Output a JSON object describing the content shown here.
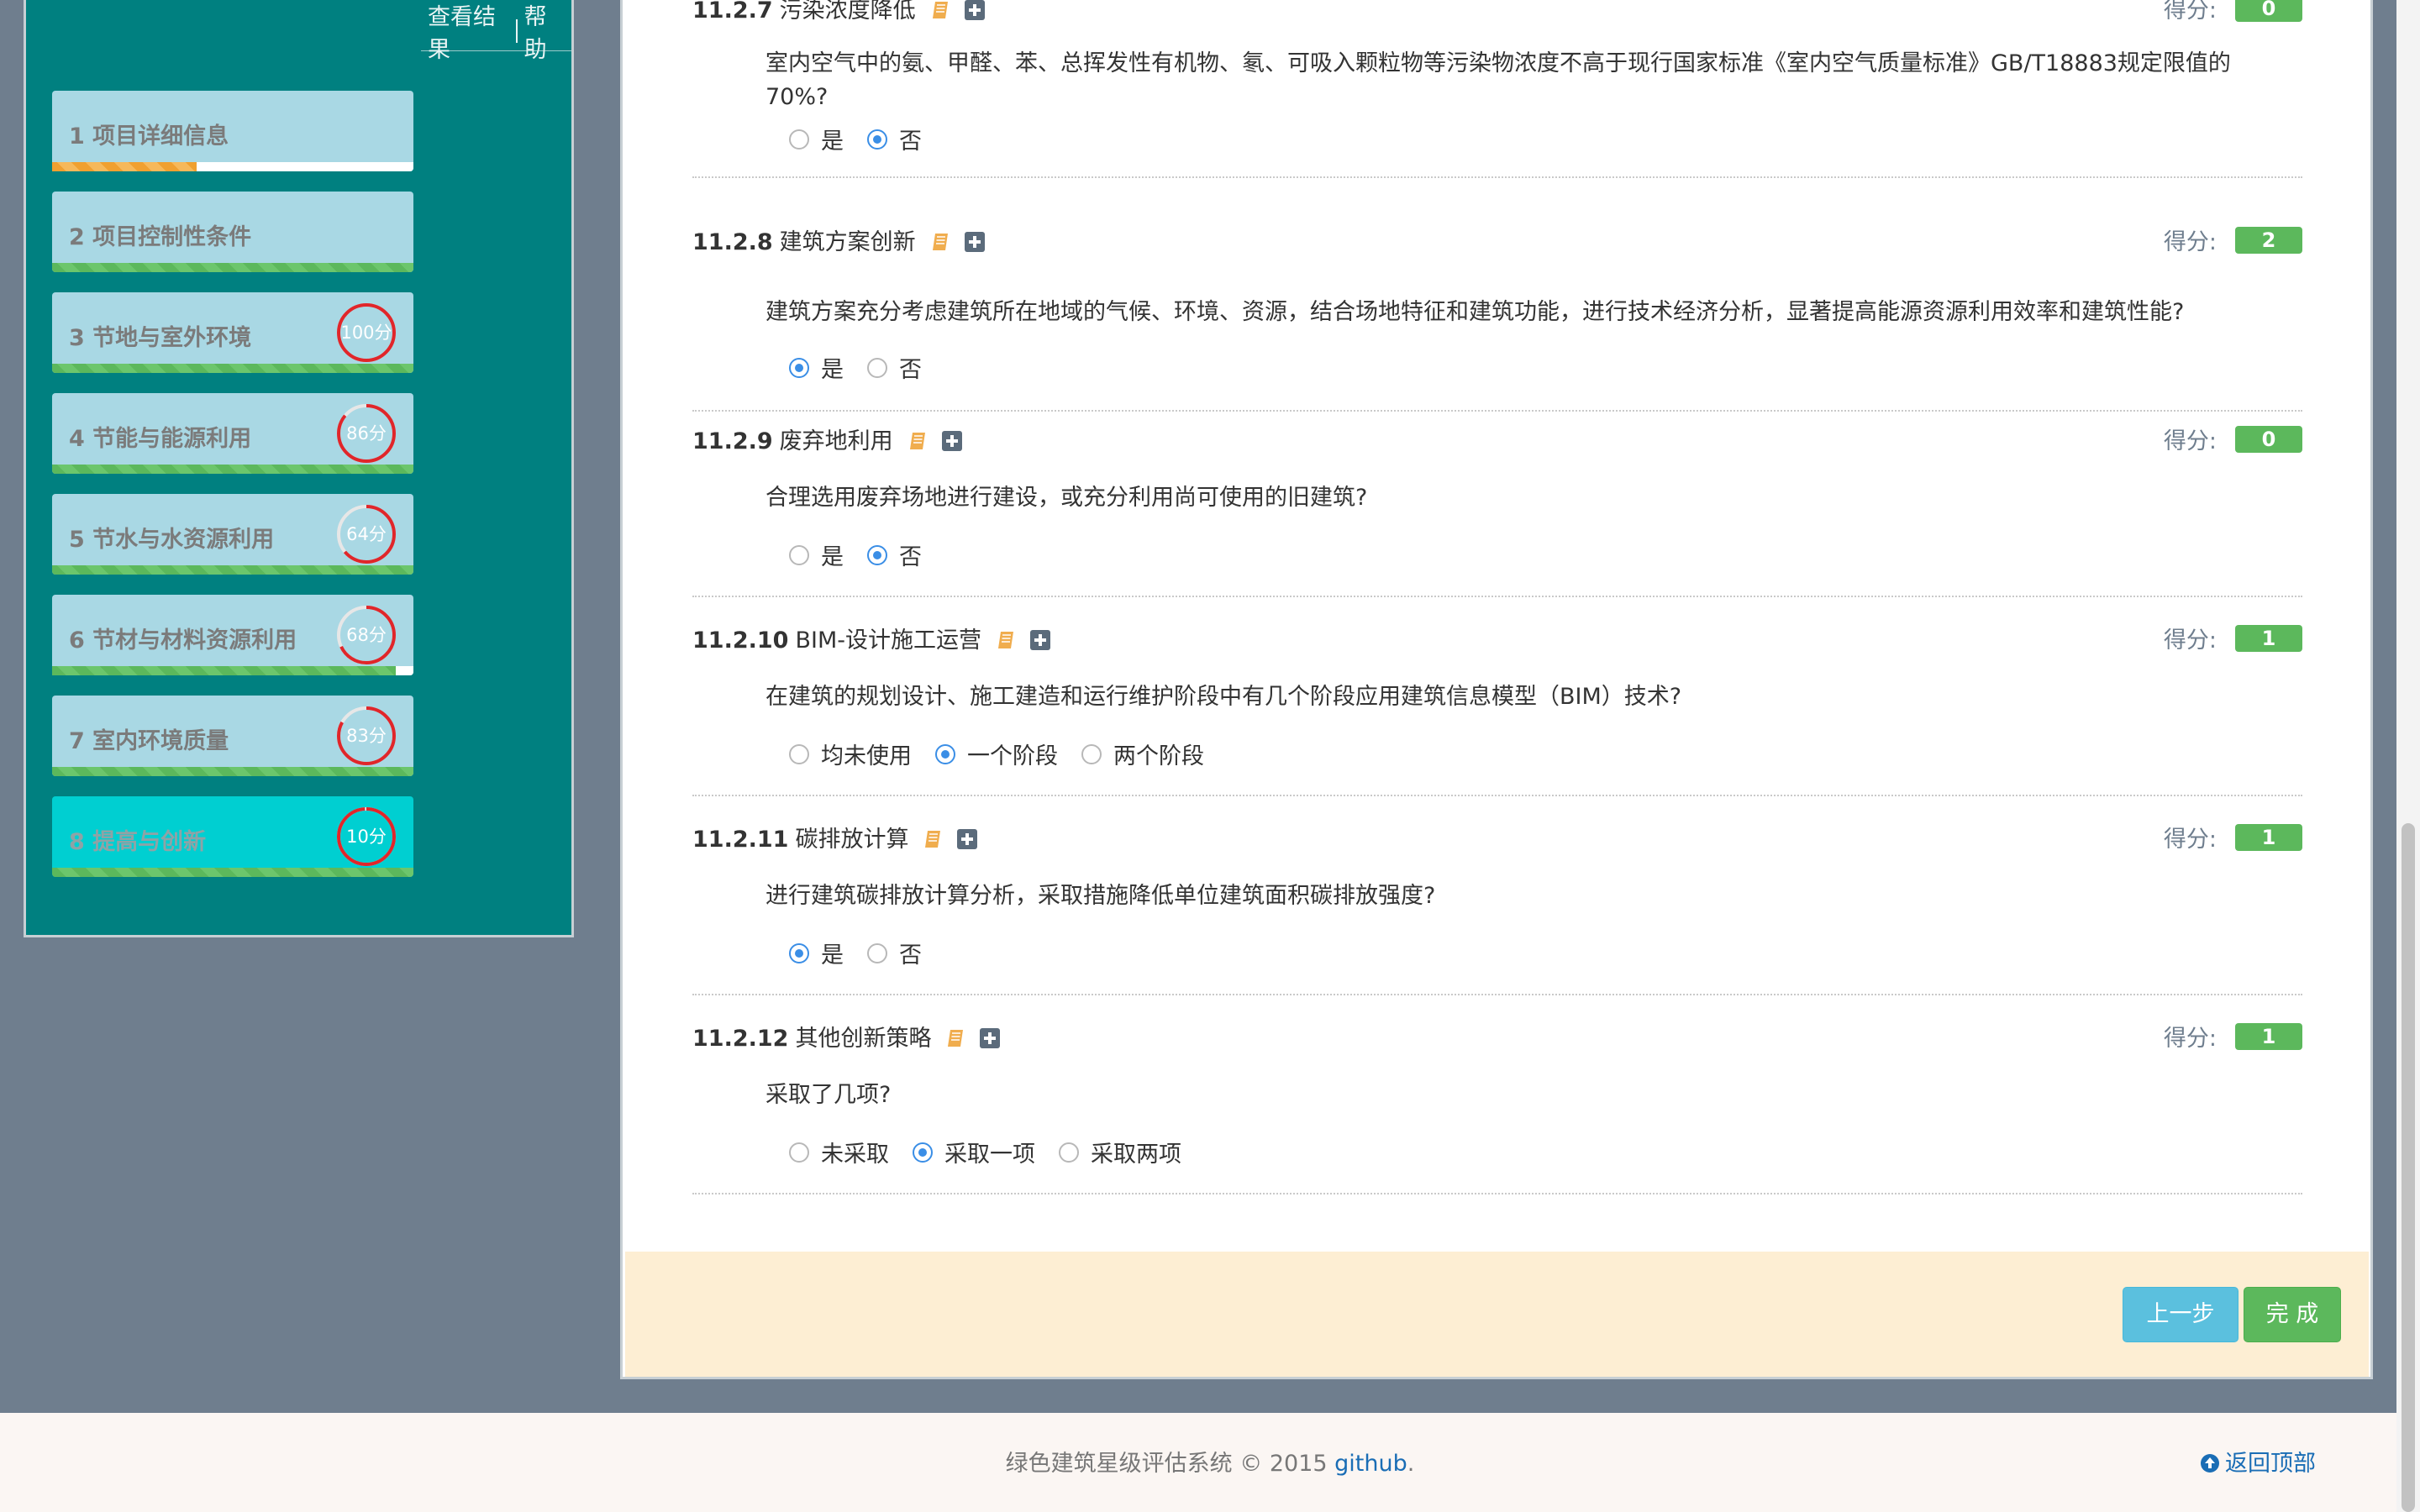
{
  "sidebar": {
    "links": {
      "results": "查看结果",
      "help": "帮助"
    },
    "steps": [
      {
        "label": "1 项目详细信息",
        "progress": 0.4,
        "progress_color": "orange"
      },
      {
        "label": "2 项目控制性条件",
        "progress": 1.0
      },
      {
        "label": "3 节地与室外环境",
        "score": "100分",
        "ring_fraction": 1.0
      },
      {
        "label": "4 节能与能源利用",
        "score": "86分",
        "ring_fraction": 0.86
      },
      {
        "label": "5 节水与水资源利用",
        "score": "64分",
        "ring_fraction": 0.64
      },
      {
        "label": "6 节材与材料资源利用",
        "score": "68分",
        "ring_fraction": 0.68,
        "progress": 0.95
      },
      {
        "label": "7 室内环境质量",
        "score": "83分",
        "ring_fraction": 0.83
      },
      {
        "label": "8 提高与创新",
        "score": "10分",
        "ring_fraction": 0.99,
        "active": true
      }
    ]
  },
  "score_label": "得分:",
  "items": [
    {
      "code": "11.2.7",
      "title": "污染浓度降低",
      "score": "0",
      "question": "室内空气中的氨、甲醛、苯、总挥发性有机物、氡、可吸入颗粒物等污染物浓度不高于现行国家标准《室内空气质量标准》GB/T18883规定限值的70%?",
      "options": [
        "是",
        "否"
      ],
      "selected": 1
    },
    {
      "code": "11.2.8",
      "title": "建筑方案创新",
      "score": "2",
      "question": "建筑方案充分考虑建筑所在地域的气候、环境、资源，结合场地特征和建筑功能，进行技术经济分析，显著提高能源资源利用效率和建筑性能?",
      "options": [
        "是",
        "否"
      ],
      "selected": 0
    },
    {
      "code": "11.2.9",
      "title": "废弃地利用",
      "score": "0",
      "question": "合理选用废弃场地进行建设，或充分利用尚可使用的旧建筑?",
      "options": [
        "是",
        "否"
      ],
      "selected": 1
    },
    {
      "code": "11.2.10",
      "title": "BIM-设计施工运营",
      "score": "1",
      "question": "在建筑的规划设计、施工建造和运行维护阶段中有几个阶段应用建筑信息模型（BIM）技术?",
      "options": [
        "均未使用",
        "一个阶段",
        "两个阶段"
      ],
      "selected": 1
    },
    {
      "code": "11.2.11",
      "title": "碳排放计算",
      "score": "1",
      "question": "进行建筑碳排放计算分析，采取措施降低单位建筑面积碳排放强度?",
      "options": [
        "是",
        "否"
      ],
      "selected": 0
    },
    {
      "code": "11.2.12",
      "title": "其他创新策略",
      "score": "1",
      "question": "采取了几项?",
      "options": [
        "未采取",
        "采取一项",
        "采取两项"
      ],
      "selected": 1
    }
  ],
  "buttons": {
    "prev": "上一步",
    "done": "完 成"
  },
  "footer": {
    "copyright": "绿色建筑星级评估系统 © 2015 ",
    "link": "github",
    "dot": ".",
    "back_to_top": "返回顶部"
  },
  "colors": {
    "sidebar_bg": "#008080",
    "step_bg": "#a9d8e4",
    "active_step_bg": "#00cfd1",
    "score_badge": "#5cb85c",
    "radio_on": "#3a8ee6",
    "ring": "#e0262a",
    "action_bar": "#fdeed3"
  },
  "icons": {
    "book": "book-icon",
    "plus": "plus-square-icon",
    "back_to_top": "arrow-circle-up-icon"
  }
}
